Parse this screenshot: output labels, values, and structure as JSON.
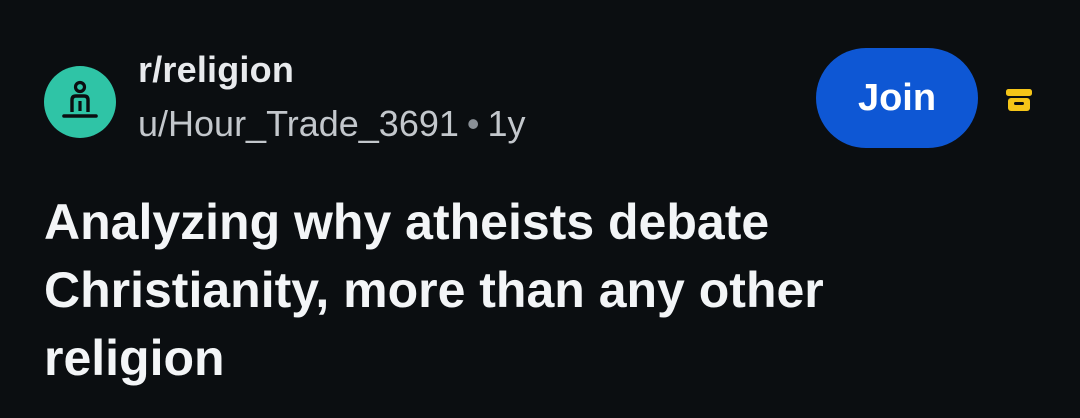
{
  "post": {
    "subreddit": "r/religion",
    "author": "u/Hour_Trade_3691",
    "separator": "•",
    "age": "1y",
    "join_label": "Join",
    "title": "Analyzing why atheists debate Christianity, more than any other religion"
  },
  "icons": {
    "avatar": "candle-icon",
    "archive": "archive-icon"
  },
  "colors": {
    "background": "#0b0e11",
    "avatar_bg": "#2fc4a6",
    "join_button": "#0e57d4",
    "archive_icon": "#f5c518"
  }
}
